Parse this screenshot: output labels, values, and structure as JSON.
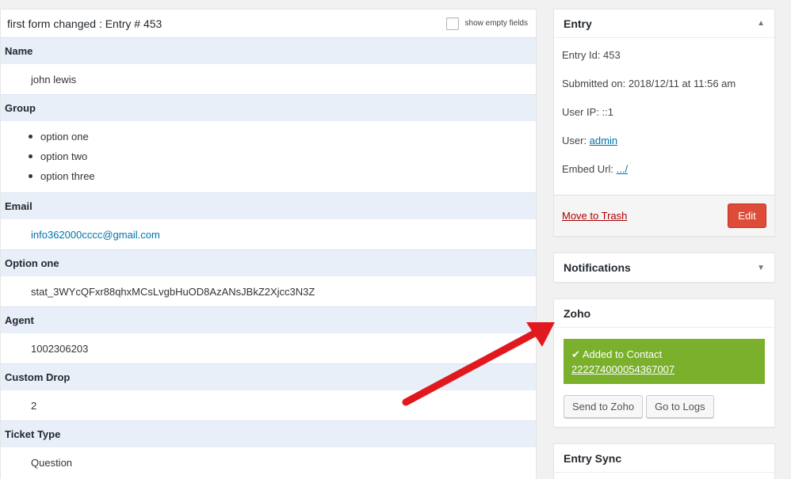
{
  "main": {
    "title": "first form changed : Entry # 453",
    "show_empty_label": "show empty fields",
    "fields": [
      {
        "label": "Name",
        "value": "john lewis"
      },
      {
        "label": "Group",
        "items": [
          "option one",
          "option two",
          "option three"
        ]
      },
      {
        "label": "Email",
        "value": "info362000cccc@gmail.com"
      },
      {
        "label": "Option one",
        "value": "stat_3WYcQFxr88qhxMCsLvgbHuOD8AzANsJBkZ2Xjcc3N3Z"
      },
      {
        "label": "Agent",
        "value": "1002306203"
      },
      {
        "label": "Custom Drop",
        "value": "2"
      },
      {
        "label": "Ticket Type",
        "value": "Question"
      }
    ]
  },
  "sidebar": {
    "entry": {
      "title": "Entry",
      "entry_id": "Entry Id: 453",
      "submitted": "Submitted on: 2018/12/11 at 11:56 am",
      "user_ip": "User IP: ::1",
      "user_label": "User: ",
      "user_link": "admin",
      "embed_label": "Embed Url: ",
      "embed_link": ".../",
      "trash": "Move to Trash",
      "edit": "Edit"
    },
    "notifications": {
      "title": "Notifications"
    },
    "zoho": {
      "title": "Zoho",
      "status": "Added to Contact",
      "contact_id": "222274000054367007",
      "send_button": "Send to Zoho",
      "logs_button": "Go to Logs"
    },
    "entry_sync": {
      "title": "Entry Sync"
    }
  },
  "icons": {
    "collapse": "triangle-up-icon",
    "expand": "triangle-down-icon",
    "check": "check-icon"
  },
  "colors": {
    "label_bg": "#e8eff9",
    "success": "#7ab02c",
    "danger": "#dd4b39",
    "arrow": "#e0191e"
  }
}
